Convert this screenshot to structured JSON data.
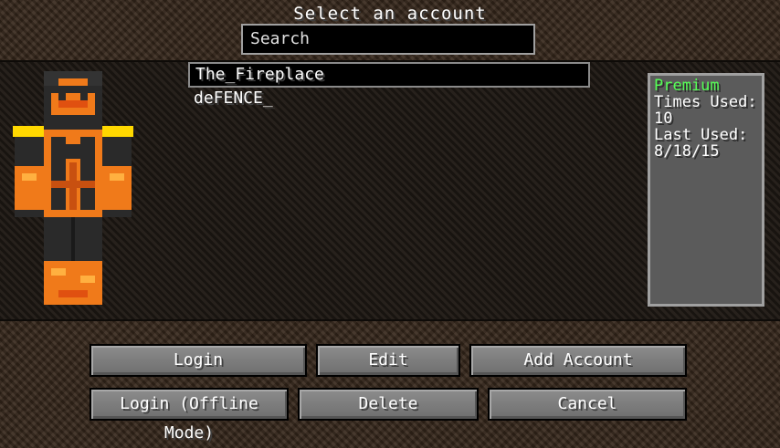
{
  "header": {
    "title": "Select an account"
  },
  "search": {
    "value": "Search"
  },
  "accounts": [
    {
      "name": "The_Fireplace"
    },
    {
      "name": "deFENCE_"
    }
  ],
  "info": {
    "status": "Premium",
    "times_used_label": "Times Used:",
    "times_used_value": "10",
    "last_used_label": "Last Used:",
    "last_used_value": "8/18/15"
  },
  "buttons": {
    "login": "Login",
    "edit": "Edit",
    "add_account": "Add Account",
    "login_offline": "Login (Offline Mode)",
    "delete": "Delete",
    "cancel": "Cancel"
  },
  "colors": {
    "premium": "#55ff55",
    "skin_orange": "#f07a1a",
    "skin_dark": "#2a2a2a"
  },
  "icons": {
    "skin_preview": "player-skin-icon"
  }
}
